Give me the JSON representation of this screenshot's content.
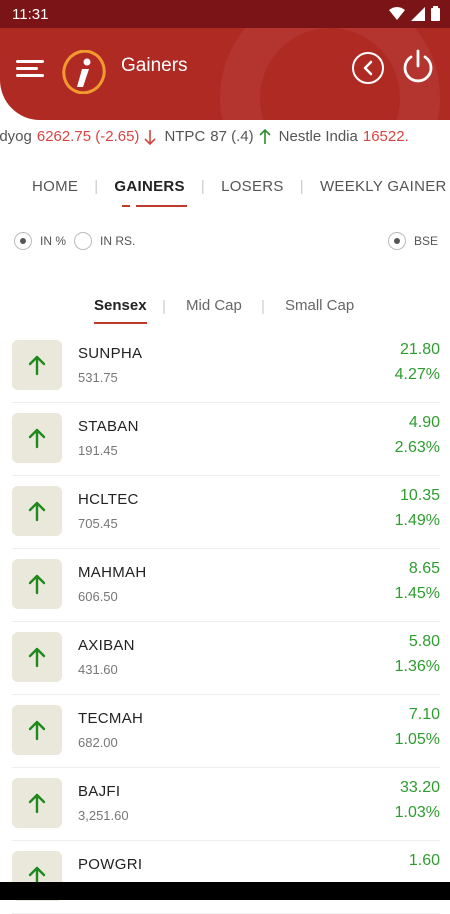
{
  "status": {
    "time": "11:31",
    "icons": [
      "wifi-icon",
      "signal-icon",
      "battery-icon"
    ]
  },
  "header": {
    "title": "Gainers",
    "logo": "i"
  },
  "ticker": [
    {
      "name": "ldyog",
      "value": "6262.75 (-2.65)",
      "dir": "down"
    },
    {
      "name": "NTPC",
      "value": "87 (.4)",
      "dir": "up"
    },
    {
      "name": "Nestle India",
      "value": "16522.",
      "dir": "none"
    }
  ],
  "tabs": [
    "HOME",
    "GAINERS",
    "LOSERS",
    "WEEKLY GAINER"
  ],
  "radios": {
    "pct": "IN %",
    "rs": "IN RS.",
    "exchange": "BSE"
  },
  "subtabs": [
    "Sensex",
    "Mid Cap",
    "Small Cap"
  ],
  "stocks": [
    {
      "symbol": "SUNPHA",
      "price": "531.75",
      "change": "21.80",
      "percent": "4.27%"
    },
    {
      "symbol": "STABAN",
      "price": "191.45",
      "change": "4.90",
      "percent": "2.63%"
    },
    {
      "symbol": "HCLTEC",
      "price": "705.45",
      "change": "10.35",
      "percent": "1.49%"
    },
    {
      "symbol": "MAHMAH",
      "price": "606.50",
      "change": "8.65",
      "percent": "1.45%"
    },
    {
      "symbol": "AXIBAN",
      "price": "431.60",
      "change": "5.80",
      "percent": "1.36%"
    },
    {
      "symbol": "TECMAH",
      "price": "682.00",
      "change": "7.10",
      "percent": "1.05%"
    },
    {
      "symbol": "BAJFI",
      "price": "3,251.60",
      "change": "33.20",
      "percent": "1.03%"
    },
    {
      "symbol": "POWGRI",
      "price": "",
      "change": "1.60",
      "percent": ""
    }
  ],
  "colors": {
    "brand": "#b02a24",
    "up": "#2e9c2e",
    "down": "#d64541"
  }
}
